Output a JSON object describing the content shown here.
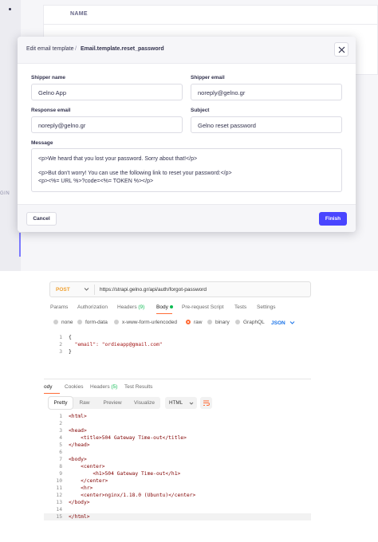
{
  "strapi": {
    "background_table": {
      "column_header": "NAME"
    },
    "sidebar_fragment": "GIN",
    "modal": {
      "breadcrumb": [
        "Edit email template",
        "/",
        "Email.template.reset_password"
      ],
      "fields": {
        "shipper_name": {
          "label": "Shipper name",
          "value": "Gelno App"
        },
        "shipper_email": {
          "label": "Shipper email",
          "value": "noreply@gelno.gr"
        },
        "response_email": {
          "label": "Response email",
          "value": "noreply@gelno.gr"
        },
        "subject": {
          "label": "Subject",
          "value": "Gelno reset password"
        },
        "message": {
          "label": "Message",
          "lines": [
            "<p>We heard that you lost your password. Sorry about that!</p>",
            "",
            "<p>But don't worry! You can use the following link to reset your password:</p>",
            "<p><%= URL %>?code=<%= TOKEN %></p>"
          ]
        }
      },
      "cancel_label": "Cancel",
      "finish_label": "Finish",
      "colors": {
        "primary": "#4945ff"
      }
    }
  },
  "postman": {
    "method": "POST",
    "url": "https://strapi.gelno.gr/api/auth/forgot-password",
    "request_tabs": [
      {
        "label": "Params"
      },
      {
        "label": "Authorization"
      },
      {
        "label": "Headers",
        "count": "(9)"
      },
      {
        "label": "Body",
        "active": true
      },
      {
        "label": "Pre-request Script"
      },
      {
        "label": "Tests"
      },
      {
        "label": "Settings"
      }
    ],
    "body_types": [
      "none",
      "form-data",
      "x-www-form-urlencoded",
      "raw",
      "binary",
      "GraphQL"
    ],
    "body_type_selected": "raw",
    "raw_format": "JSON",
    "request_body": {
      "line_numbers": [
        "1",
        "2",
        "3"
      ],
      "lines": [
        "{",
        "\"email\": \"ordieapp@gmail.com\"",
        "}"
      ]
    },
    "response_tabs": [
      {
        "label": "Body",
        "display": "ody",
        "active": true
      },
      {
        "label": "Cookies"
      },
      {
        "label": "Headers",
        "count": "(5)"
      },
      {
        "label": "Test Results"
      }
    ],
    "view_modes": [
      "Pretty",
      "Raw",
      "Preview",
      "Visualize"
    ],
    "view_selected": "Pretty",
    "response_format": "HTML",
    "response_body": {
      "line_numbers": [
        "1",
        "2",
        "3",
        "4",
        "5",
        "6",
        "7",
        "8",
        "9",
        "10",
        "11",
        "12",
        "13",
        "14",
        "15"
      ],
      "lines": [
        "<html>",
        "",
        "<head>",
        "<title>504 Gateway Time-out</title>",
        "</head>",
        "",
        "<body>",
        "<center>",
        "<h1>504 Gateway Time-out</h1>",
        "</center>",
        "<hr>",
        "<center>nginx/1.18.0 (Ubuntu)</center>",
        "</body>",
        "",
        "</html>"
      ]
    },
    "colors": {
      "accent": "#ff6c37",
      "success": "#0cbb52",
      "link": "#1a73e8"
    }
  }
}
